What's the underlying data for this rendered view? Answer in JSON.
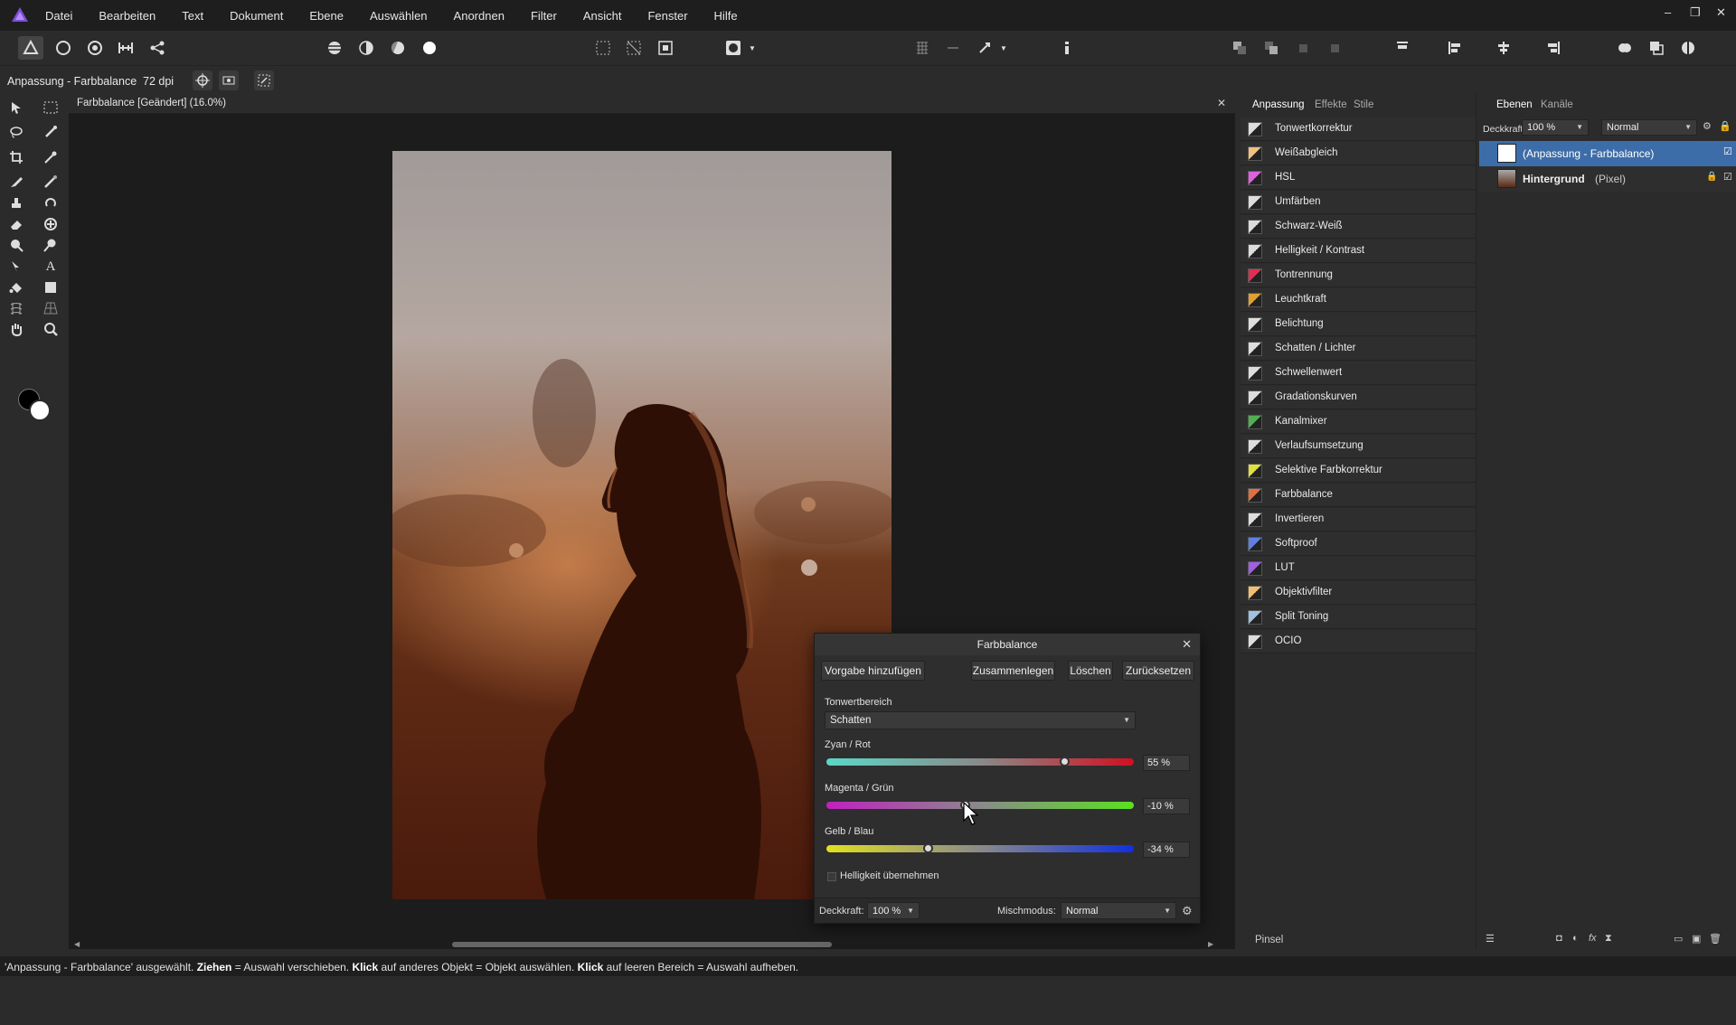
{
  "menu": [
    "Datei",
    "Bearbeiten",
    "Text",
    "Dokument",
    "Ebene",
    "Auswählen",
    "Anordnen",
    "Filter",
    "Ansicht",
    "Fenster",
    "Hilfe"
  ],
  "window_controls": {
    "minimize": "–",
    "restore": "❐",
    "close": "✕"
  },
  "context": {
    "selection_label": "Anpassung - Farbbalance",
    "dpi": "72 dpi"
  },
  "document": {
    "tab_title": "Farbbalance [Geändert] (16.0%)"
  },
  "adjustments_panel": {
    "tabs": [
      "Anpassung",
      "Effekte",
      "Stile"
    ],
    "items": [
      "Tonwertkorrektur",
      "Weißabgleich",
      "HSL",
      "Umfärben",
      "Schwarz-Weiß",
      "Helligkeit / Kontrast",
      "Tontrennung",
      "Leuchtkraft",
      "Belichtung",
      "Schatten / Lichter",
      "Schwellenwert",
      "Gradationskurven",
      "Kanalmixer",
      "Verlaufsumsetzung",
      "Selektive Farbkorrektur",
      "Farbbalance",
      "Invertieren",
      "Softproof",
      "LUT",
      "Objektivfilter",
      "Split Toning",
      "OCIO"
    ],
    "brush_tab": "Pinsel"
  },
  "layers_panel": {
    "tabs": [
      "Ebenen",
      "Kanäle"
    ],
    "opacity_label": "Deckkraft:",
    "opacity_value": "100 %",
    "blend_mode": "Normal",
    "layers": [
      {
        "name": "(Anpassung - Farbbalance)",
        "selected": true
      },
      {
        "name": "Hintergrund",
        "suffix": "(Pixel)",
        "selected": false
      }
    ]
  },
  "dialog": {
    "title": "Farbbalance",
    "buttons": [
      "Vorgabe hinzufügen",
      "Zusammenlegen",
      "Löschen",
      "Zurücksetzen"
    ],
    "tone_range_label": "Tonwertbereich",
    "tone_range_value": "Schatten",
    "sliders": [
      {
        "label": "Zyan / Rot",
        "value": "55 %",
        "level": 55
      },
      {
        "label": "Magenta / Grün",
        "value": "-10 %",
        "level": -10
      },
      {
        "label": "Gelb / Blau",
        "value": "-34 %",
        "level": -34
      }
    ],
    "preserve_luminosity": "Helligkeit übernehmen",
    "opacity_label": "Deckkraft:",
    "opacity_value": "100 %",
    "blend_label": "Mischmodus:",
    "blend_value": "Normal"
  },
  "status": {
    "part1": "'Anpassung - Farbbalance' ausgewählt. ",
    "b1": "Ziehen",
    "part2": " = Auswahl verschieben. ",
    "b2": "Klick",
    "part3": " auf anderes Objekt = Objekt auswählen. ",
    "b3": "Klick",
    "part4": " auf leeren Bereich = Auswahl aufheben."
  },
  "colors": {
    "accent": "#4a7fc1",
    "selection": "#3d6da8"
  }
}
